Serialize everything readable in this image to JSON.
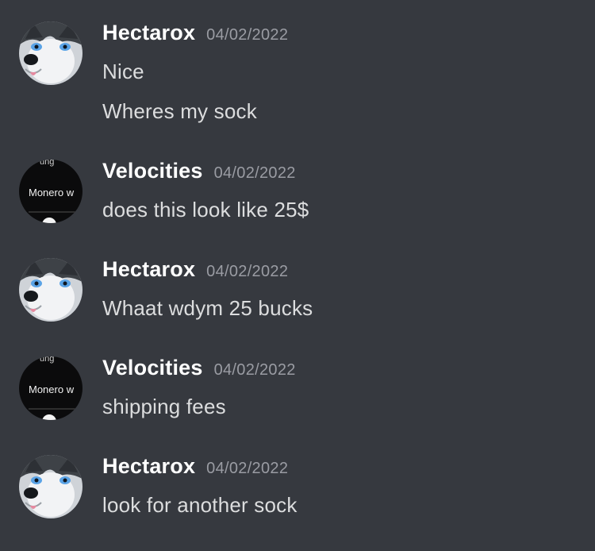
{
  "messages": [
    {
      "author": "Hectarox",
      "timestamp": "04/02/2022",
      "avatar": "husky-avatar",
      "lines": [
        "Nice",
        "Wheres my sock"
      ]
    },
    {
      "author": "Velocities",
      "timestamp": "04/02/2022",
      "avatar": "monero-avatar",
      "avatar_text": "Monero w",
      "lines": [
        "does this look like 25$"
      ]
    },
    {
      "author": "Hectarox",
      "timestamp": "04/02/2022",
      "avatar": "husky-avatar",
      "lines": [
        "Whaat wdym 25 bucks"
      ]
    },
    {
      "author": "Velocities",
      "timestamp": "04/02/2022",
      "avatar": "monero-avatar",
      "avatar_text": "Monero w",
      "lines": [
        "shipping fees"
      ]
    },
    {
      "author": "Hectarox",
      "timestamp": "04/02/2022",
      "avatar": "husky-avatar",
      "lines": [
        "look for another sock"
      ]
    }
  ],
  "colors": {
    "background": "#36393f",
    "username": "#ffffff",
    "timestamp": "#9a9ca3",
    "text": "#dcddde"
  }
}
